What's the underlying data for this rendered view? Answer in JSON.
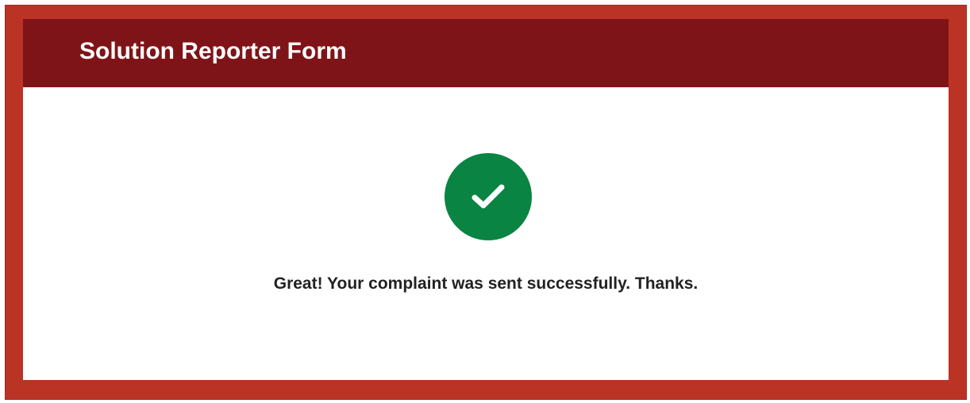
{
  "colors": {
    "frame_background": "#bb3325",
    "header_background": "#7f1418",
    "success_green": "#0a8442",
    "check_color": "#ffffff"
  },
  "form": {
    "title": "Solution Reporter Form"
  },
  "confirmation": {
    "icon": "check-circle-icon",
    "message": "Great! Your complaint was sent successfully. Thanks."
  }
}
